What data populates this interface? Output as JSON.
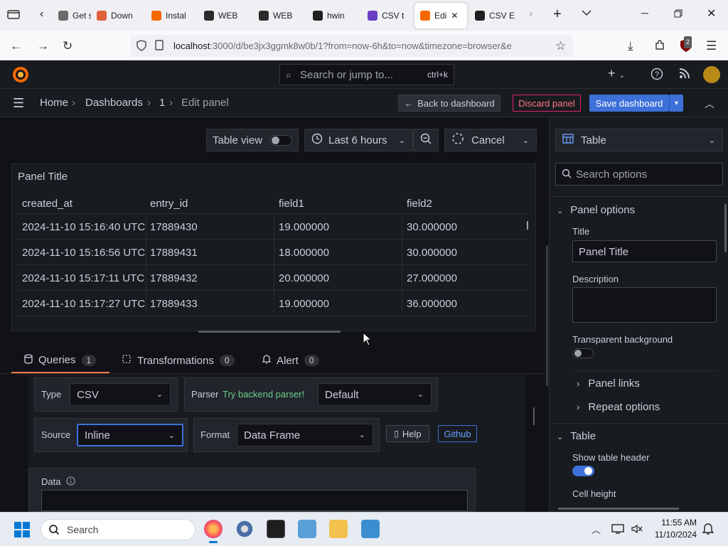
{
  "browser": {
    "tabs": [
      {
        "label": "Get st",
        "color": "#6b6b6b"
      },
      {
        "label": "Down",
        "color": "#e0603a"
      },
      {
        "label": "Instal",
        "color": "#f46800"
      },
      {
        "label": "WEB",
        "color": "#2b2b2b"
      },
      {
        "label": "WEB",
        "color": "#2b2b2b"
      },
      {
        "label": "hwin",
        "color": "#1f1f1f"
      },
      {
        "label": "CSV t",
        "color": "#6a3fc2"
      },
      {
        "label": "Edi",
        "color": "#f46800"
      },
      {
        "label": "CSV E",
        "color": "#1f1f1f"
      }
    ],
    "url_host": "localhost",
    "url_rest": ":3000/d/be3jx3ggmk8w0b/1?from=now-6h&to=now&timezone=browser&e",
    "ext_badge": "2"
  },
  "grafana": {
    "search_placeholder": "Search or jump to...",
    "search_shortcut": "ctrl+k",
    "breadcrumbs": [
      "Home",
      "Dashboards",
      "1",
      "Edit panel"
    ],
    "back_label": "Back to dashboard",
    "discard_label": "Discard panel",
    "save_label": "Save dashboard"
  },
  "toolbar": {
    "table_view": "Table view",
    "time_range": "Last 6 hours",
    "cancel": "Cancel"
  },
  "panel": {
    "title": "Panel Title",
    "columns": [
      "created_at",
      "entry_id",
      "field1",
      "field2"
    ],
    "rows": [
      [
        "2024-11-10 15:16:40 UTC",
        "17889430",
        "19.000000",
        "30.000000"
      ],
      [
        "2024-11-10 15:16:56 UTC",
        "17889431",
        "18.000000",
        "30.000000"
      ],
      [
        "2024-11-10 15:17:11 UTC",
        "17889432",
        "20.000000",
        "27.000000"
      ],
      [
        "2024-11-10 15:17:27 UTC",
        "17889433",
        "19.000000",
        "36.000000"
      ]
    ]
  },
  "query_tabs": [
    {
      "label": "Queries",
      "count": "1"
    },
    {
      "label": "Transformations",
      "count": "0"
    },
    {
      "label": "Alert",
      "count": "0"
    }
  ],
  "query": {
    "type_label": "Type",
    "type_value": "CSV",
    "parser_label": "Parser",
    "parser_hint": "Try backend parser!",
    "parser_value": "Default",
    "source_label": "Source",
    "source_value": "Inline",
    "format_label": "Format",
    "format_value": "Data Frame",
    "help_label": "Help",
    "github_label": "Github",
    "data_label": "Data"
  },
  "options": {
    "viz": "Table",
    "search_placeholder": "Search options",
    "panel_options": "Panel options",
    "title_label": "Title",
    "title_value": "Panel Title",
    "description_label": "Description",
    "transparent_label": "Transparent background",
    "panel_links": "Panel links",
    "repeat_options": "Repeat options",
    "table_section": "Table",
    "show_header_label": "Show table header",
    "cell_height_label": "Cell height"
  },
  "taskbar": {
    "search": "Search",
    "time": "11:55 AM",
    "date": "11/10/2024"
  }
}
